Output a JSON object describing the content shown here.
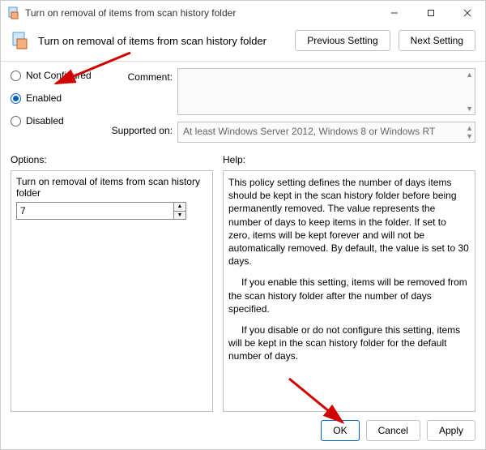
{
  "window": {
    "title": "Turn on removal of items from scan history folder"
  },
  "header": {
    "title": "Turn on removal of items from scan history folder",
    "prev_label": "Previous Setting",
    "next_label": "Next Setting"
  },
  "state": {
    "not_configured_label": "Not Configured",
    "enabled_label": "Enabled",
    "disabled_label": "Disabled",
    "selected": "enabled"
  },
  "comment": {
    "label": "Comment:",
    "value": ""
  },
  "supported": {
    "label": "Supported on:",
    "value": "At least Windows Server 2012, Windows 8 or Windows RT"
  },
  "options": {
    "label": "Options:",
    "item_title": "Turn on removal of items from scan history folder",
    "days_value": "7"
  },
  "help": {
    "label": "Help:",
    "p1": "This policy setting defines the number of days items should be kept in the scan history folder before being permanently removed. The value represents the number of days to keep items in the folder. If set to zero, items will be kept forever and will not be automatically removed. By default, the value is set to 30 days.",
    "p2": "If you enable this setting, items will be removed from the scan history folder after the number of days specified.",
    "p3": "If you disable or do not configure this setting, items will be kept in the scan history folder for the default number of days."
  },
  "footer": {
    "ok_label": "OK",
    "cancel_label": "Cancel",
    "apply_label": "Apply"
  }
}
